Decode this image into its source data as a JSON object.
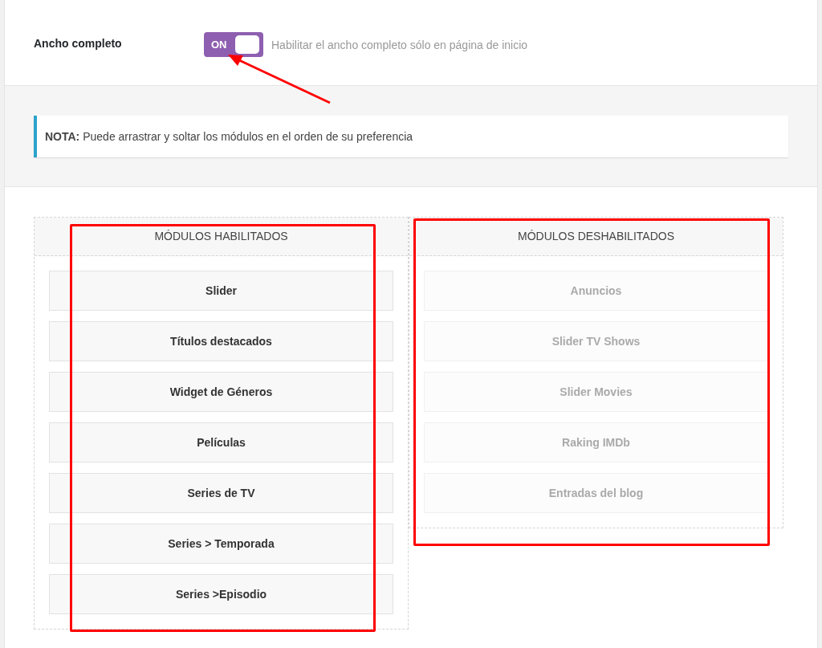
{
  "setting": {
    "label": "Ancho completo",
    "toggle": {
      "label": "ON",
      "on": true
    },
    "description": "Habilitar el ancho completo sólo en página de inicio"
  },
  "note": "**NOTA:** Puede arrastrar y soltar los módulos en el orden de su preferencia",
  "columns": [
    {
      "title": "MÓDULOS HABILITADOS",
      "items": [
        {
          "label": "Slider",
          "disabled": false
        },
        {
          "label": "Títulos destacados",
          "disabled": false
        },
        {
          "label": "Widget de Géneros",
          "disabled": false
        },
        {
          "label": "Películas",
          "disabled": false
        },
        {
          "label": "Series de TV",
          "disabled": false
        },
        {
          "label": "Series > Temporada",
          "disabled": false
        },
        {
          "label": "Series >Episodio",
          "disabled": false
        }
      ]
    },
    {
      "title": "MÓDULOS DESHABILITADOS",
      "items": [
        {
          "label": "Anuncios",
          "disabled": true
        },
        {
          "label": "Slider TV Shows",
          "disabled": true
        },
        {
          "label": "Slider Movies",
          "disabled": true
        },
        {
          "label": "Raking IMDb",
          "disabled": true
        },
        {
          "label": "Entradas del blog",
          "disabled": true
        }
      ]
    }
  ]
}
